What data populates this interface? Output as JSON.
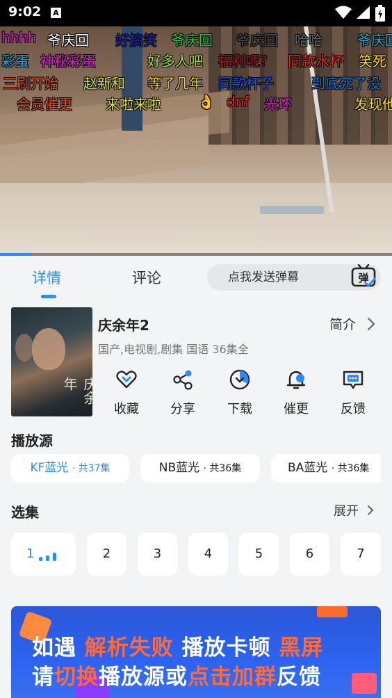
{
  "status_bar": {
    "time": "9:02",
    "notification_icon": "A"
  },
  "video": {
    "progress": 0.08,
    "danmaku": [
      {
        "text": "hhhh",
        "color": "#e01ad0"
      },
      {
        "text": "爷庆回",
        "color": "#ffffff"
      },
      {
        "text": "好搞笑",
        "color": "#1a2aa8"
      },
      {
        "text": "爷庆回",
        "color": "#1ec83a"
      },
      {
        "text": "爷庆回",
        "color": "#4a4a4a"
      },
      {
        "text": "哈哈",
        "color": "#6a6a6a"
      },
      {
        "text": "爷庆回",
        "color": "#2aa8c8"
      },
      {
        "text": "彩蛋",
        "color": "#2aa8d8"
      },
      {
        "text": "神秘彩蛋",
        "color": "#e01ad0"
      },
      {
        "text": "好多人吧",
        "color": "#aee81a"
      },
      {
        "text": "福利呢?",
        "color": "#a0162a"
      },
      {
        "text": "同款水杯",
        "color": "#e8321a"
      },
      {
        "text": "笑死",
        "color": "#ffe01a"
      },
      {
        "text": "三刷开始",
        "color": "#e0501a"
      },
      {
        "text": "赵新和",
        "color": "#d8e81a"
      },
      {
        "text": "等了几年",
        "color": "#e8d81a"
      },
      {
        "text": "同款杯子",
        "color": "#1a50e8"
      },
      {
        "text": "到底死了没",
        "color": "#1a78c8"
      },
      {
        "text": "会员催更",
        "color": "#e0501a"
      },
      {
        "text": "来啦来啦",
        "color": "#e8e81a"
      },
      {
        "text": "👌",
        "color": "#f0b81a"
      },
      {
        "text": "dnf",
        "color": "#e8201a"
      },
      {
        "text": "光环",
        "color": "#e01ad0"
      },
      {
        "text": "发现他",
        "color": "#ffe01a"
      }
    ]
  },
  "tabs": {
    "details": "详情",
    "comments": "评论"
  },
  "danmaku_input": {
    "placeholder": "点我发送弹幕",
    "toggle_glyph": "弹"
  },
  "show": {
    "title": "庆余年2",
    "intro_label": "简介",
    "meta": "国产,电视剧,剧集 国语 36集全",
    "poster_text": "庆余年"
  },
  "actions": [
    {
      "label": "收藏",
      "icon": "heart-icon"
    },
    {
      "label": "分享",
      "icon": "share-icon"
    },
    {
      "label": "下载",
      "icon": "download-icon"
    },
    {
      "label": "催更",
      "icon": "bell-icon"
    },
    {
      "label": "反馈",
      "icon": "feedback-icon"
    }
  ],
  "sources_section": {
    "title": "播放源",
    "items": [
      {
        "name": "KF蓝光",
        "count": "· 共37集",
        "active": true
      },
      {
        "name": "NB蓝光",
        "count": "· 共36集",
        "active": false
      },
      {
        "name": "BA蓝光",
        "count": "· 共36集",
        "active": false
      }
    ]
  },
  "episodes_section": {
    "title": "选集",
    "expand_label": "展开",
    "items": [
      "1",
      "2",
      "3",
      "4",
      "5",
      "6",
      "7"
    ],
    "active_index": 0
  },
  "banner": {
    "line1": {
      "a": "如遇",
      "b": "解析失败",
      "c": "播放卡顿",
      "d": "黑屏"
    },
    "line2": {
      "a": "请",
      "b": "切换",
      "c": "播放源或",
      "d": "点击加群",
      "e": "反馈"
    }
  },
  "colors": {
    "accent": "#2f89ff",
    "banner_bg": "#2c63f0",
    "banner_highlight": "#ff6a3d"
  }
}
